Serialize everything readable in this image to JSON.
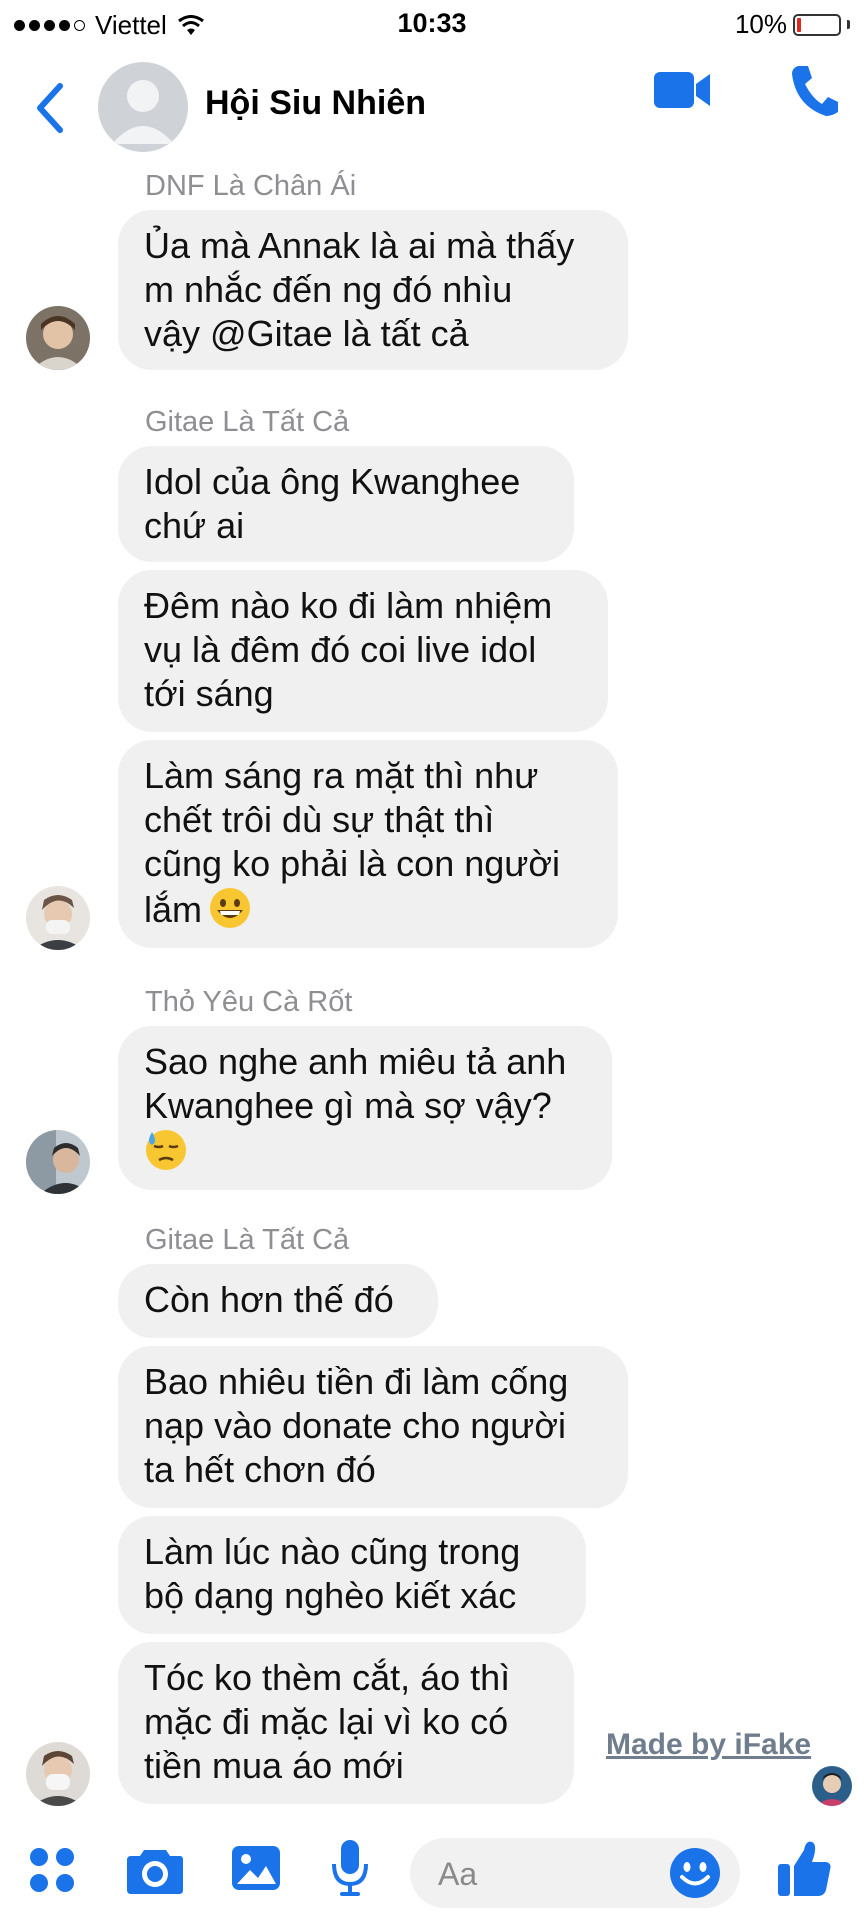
{
  "status_bar": {
    "carrier": "Viettel",
    "time": "10:33",
    "battery": "10%"
  },
  "header": {
    "title": "Hội Siu Nhiên"
  },
  "messages": [
    {
      "sender": "DNF Là Chân Ái",
      "bubbles": [
        {
          "lines": [
            "Ủa mà Annak là ai mà thấy",
            "m nhắc đến ng đó nhìu",
            "vậy @Gitae là tất cả"
          ]
        }
      ]
    },
    {
      "sender": "Gitae Là Tất Cả",
      "bubbles": [
        {
          "lines": [
            "Idol của ông Kwanghee",
            "chứ ai"
          ]
        },
        {
          "lines": [
            "Đêm nào ko đi làm nhiệm",
            "vụ là đêm đó coi live idol",
            "tới sáng"
          ]
        },
        {
          "lines": [
            "Làm sáng ra mặt thì như",
            "chết trôi dù sự thật thì",
            "cũng ko phải là con người",
            "lắm"
          ]
        }
      ]
    },
    {
      "sender": "Thỏ Yêu Cà Rốt",
      "bubbles": [
        {
          "lines": [
            "Sao nghe anh miêu tả anh",
            "Kwanghee gì mà sợ vậy?"
          ]
        }
      ]
    },
    {
      "sender": "Gitae Là Tất Cả",
      "bubbles": [
        {
          "lines": [
            "Còn hơn thế đó"
          ]
        },
        {
          "lines": [
            "Bao nhiêu tiền đi làm cống",
            "nạp vào donate cho người",
            "ta hết chơn đó"
          ]
        },
        {
          "lines": [
            "Làm lúc nào cũng trong",
            "bộ dạng nghèo kiết xác"
          ]
        },
        {
          "lines": [
            "Tóc ko thèm cắt, áo thì",
            "mặc đi mặc lại vì ko có",
            "tiền mua áo mới"
          ]
        }
      ]
    }
  ],
  "watermark": "Made by iFake",
  "composer": {
    "placeholder": "Aa"
  },
  "colors": {
    "accent": "#1a73e8",
    "bubble": "#f0f0f0",
    "sender": "#8e8e93"
  },
  "icons": [
    "back-chevron-icon",
    "video-call-icon",
    "phone-call-icon",
    "apps-icon",
    "camera-icon",
    "gallery-icon",
    "microphone-icon",
    "emoji-icon",
    "thumbs-up-icon"
  ]
}
